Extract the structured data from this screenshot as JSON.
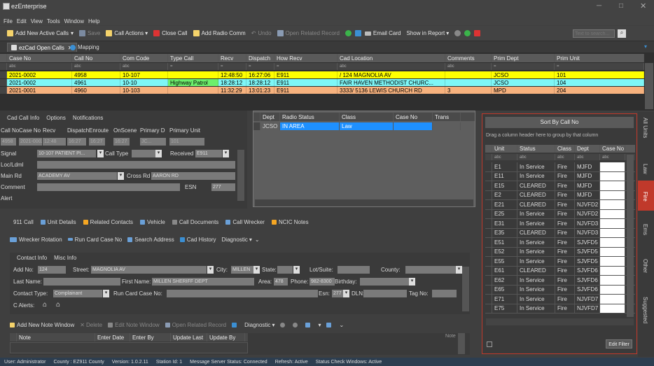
{
  "window": {
    "title": "ezEnterprise"
  },
  "menu": [
    "File",
    "Edit",
    "View",
    "Tools",
    "Window",
    "Help"
  ],
  "toolbar": {
    "add_active_calls": "Add New Active Calls",
    "save": "Save",
    "call_actions": "Call Actions",
    "close_call": "Close Call",
    "add_radio_comm": "Add Radio Comm",
    "undo": "Undo",
    "open_related_record": "Open Related Record",
    "email_card": "Email Card",
    "show_in_report": "Show in Report",
    "search_placeholder": "Text to search..."
  },
  "tabs": [
    {
      "label": "ezCad Open Calls"
    },
    {
      "label": "Mapping"
    }
  ],
  "calls_grid": {
    "columns": [
      "Case No",
      "Call No",
      "Com Code",
      "Type Call",
      "Recv",
      "Dispatch",
      "How Recv",
      "Cad Location",
      "Comments",
      "Prim Dept",
      "Prim Unit"
    ],
    "filters": [
      "abc",
      "abc",
      "abc",
      "=",
      "=",
      "=",
      "=",
      "abc",
      "abc",
      "=",
      "="
    ],
    "rows": [
      [
        "2021-0002",
        "4958",
        "10-107",
        "",
        "12:48:50",
        "16:27:06",
        "E911",
        "/ 124 MAGNOLIA AV",
        "",
        "JCSO",
        "101"
      ],
      [
        "2021-0002",
        "4961",
        "10-10",
        "Highway Patrol",
        "18:28:12",
        "18:28:12",
        "E911",
        "FAIR HAVEN METHODIST CHURC...",
        "",
        "JCSO",
        "104"
      ],
      [
        "2021-0001",
        "4960",
        "10-103",
        "",
        "11:32:29",
        "13:01:23",
        "E911",
        "3333/ 5136 LEWIS CHURCH RD",
        "3",
        "MPD",
        "204"
      ]
    ]
  },
  "call_info": {
    "tabs": [
      "Cad Call Info",
      "Options",
      "Notifications"
    ],
    "headers": [
      "Call No",
      "Case No",
      "Recv",
      "Dispatch",
      "Enroute",
      "OnScene",
      "Primary D",
      "Primary Unit"
    ],
    "values": [
      "4958",
      "2021-0002",
      "12:48",
      "16:27",
      "16:27",
      "16:27",
      "JC...",
      "101"
    ],
    "signal_label": "Signal",
    "signal_value": "10-107 PATIENT PI...",
    "call_type_label": "Call Type",
    "received_label": "Received",
    "received_value": "E911",
    "loc_label": "Loc/Ldml",
    "main_rd_label": "Main Rd",
    "main_rd_value": "ACADEMY AV",
    "cross_rd_label": "Cross Rd",
    "cross_rd_value": "AARON RD",
    "comment_label": "Comment",
    "esn_label": "ESN",
    "esn_value": "277",
    "alert_label": "Alert"
  },
  "radio_grid": {
    "columns": [
      "Dept",
      "Radio Status",
      "Class",
      "Case No",
      "Trans"
    ],
    "rows": [
      [
        "JCSO",
        "IN AREA",
        "Law",
        "",
        ""
      ]
    ]
  },
  "bottom_tabs": [
    "911 Call",
    "Unit Details",
    "Related Contacts",
    "Vehicle",
    "Call Documents",
    "Call Wrecker",
    "NCIC Notes"
  ],
  "bottom_toolbar": [
    "Wrecker Rotation",
    "Run Card Case No",
    "Search Address",
    "Cad History",
    "Diagnostic"
  ],
  "contact": {
    "tabs": [
      "Contact Info",
      "Misc Info"
    ],
    "add_no_label": "Add No:",
    "add_no_value": "124",
    "street_label": "Street:",
    "street_value": "MAGNOLIA AV",
    "city_label": "City:",
    "city_value": "MILLEN",
    "state_label": "State:",
    "lot_label": "Lot/Suite:",
    "county_label": "County:",
    "last_name_label": "Last Name:",
    "first_name_label": "First Name:",
    "first_name_value": "MILLEN SHERIFF DEPT",
    "area_label": "Area:",
    "area_value": "478",
    "phone_label": "Phone:",
    "phone_value": "982-8300",
    "birthday_label": "Birthday:",
    "contact_type_label": "Contact Type:",
    "contact_type_value": "Complainant",
    "run_card_label": "Run Card Case No:",
    "esn_label": "Esn:",
    "esn_value": "277",
    "dln_label": "DLN:",
    "tag_label": "Tag No:",
    "c_alerts_label": "C Alerts:"
  },
  "notes_toolbar": [
    "Add New Note Window",
    "Delete",
    "Edit Note Window",
    "Open Related Record",
    "Diagnostic"
  ],
  "notes_grid": {
    "columns": [
      "Note",
      "Enter Date",
      "Enter By",
      "Update Last",
      "Update By"
    ],
    "side_label": "Note"
  },
  "units_panel": {
    "title": "Sort By Call No",
    "group_hint": "Drag a column header here to group by that column",
    "columns": [
      "Unit",
      "Status",
      "Class",
      "Dept",
      "Case No"
    ],
    "filters": [
      "abc",
      "abc",
      "abc",
      "abc",
      "abc"
    ],
    "rows": [
      [
        "E1",
        "In Service",
        "Fire",
        "MJFD",
        ""
      ],
      [
        "E11",
        "In Service",
        "Fire",
        "MJFD",
        ""
      ],
      [
        "E15",
        "CLEARED",
        "Fire",
        "MJFD",
        ""
      ],
      [
        "E2",
        "CLEARED",
        "Fire",
        "MJFD",
        ""
      ],
      [
        "E21",
        "CLEARED",
        "Fire",
        "NJVFD2",
        ""
      ],
      [
        "E25",
        "In Service",
        "Fire",
        "NJVFD2",
        ""
      ],
      [
        "E31",
        "In Service",
        "Fire",
        "NJVFD3",
        ""
      ],
      [
        "E35",
        "CLEARED",
        "Fire",
        "NJVFD3",
        ""
      ],
      [
        "E51",
        "In Service",
        "Fire",
        "SJVFD5",
        ""
      ],
      [
        "E52",
        "In Service",
        "Fire",
        "SJVFD5",
        ""
      ],
      [
        "E55",
        "In Service",
        "Fire",
        "SJVFD5",
        ""
      ],
      [
        "E61",
        "CLEARED",
        "Fire",
        "SJVFD6",
        ""
      ],
      [
        "E62",
        "In Service",
        "Fire",
        "SJVFD6",
        ""
      ],
      [
        "E65",
        "In Service",
        "Fire",
        "SJVFD6",
        ""
      ],
      [
        "E71",
        "In Service",
        "Fire",
        "NJVFD7",
        ""
      ],
      [
        "E75",
        "In Service",
        "Fire",
        "NJVFD7",
        ""
      ]
    ],
    "edit_filter": "Edit Filter"
  },
  "side_tabs": [
    "All Units",
    "Law",
    "Fire",
    "Ems",
    "Other",
    "Suggested"
  ],
  "status_bar": [
    "User: Administrator",
    "County : EZ911 County",
    "Version: 1.0.2.11",
    "Station Id: 1",
    "Message Server Status: Connected",
    "Refresh: Active",
    "Status Check Windows: Active"
  ],
  "colors": {
    "yellow_row": "#ffff00",
    "cyan_row": "#7ef7f7",
    "orange_row": "#f7b27e",
    "radio_row": "#1e90ff",
    "fire_tab": "#c0392b",
    "status_bar": "#2d3e50"
  }
}
